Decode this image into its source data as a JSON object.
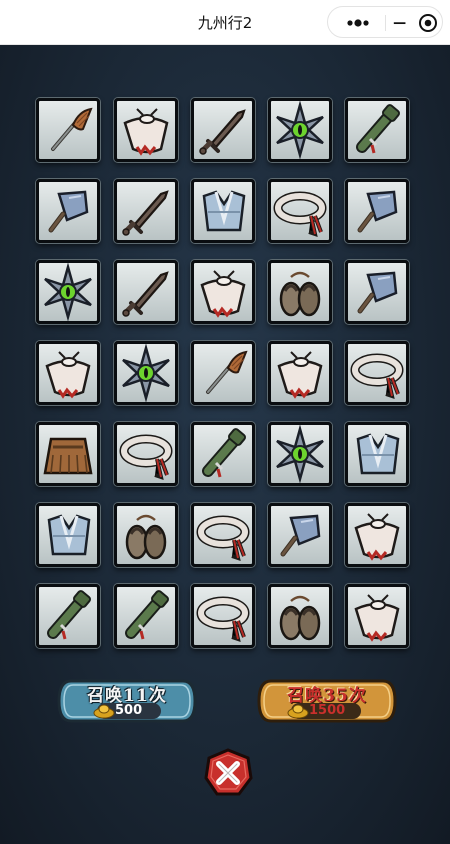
{
  "app": {
    "title": "九州行2"
  },
  "grid": {
    "rows": [
      [
        "broom",
        "scarf",
        "dagger",
        "shuriken",
        "scroll"
      ],
      [
        "cleaver",
        "dagger",
        "vest",
        "headband",
        "cleaver"
      ],
      [
        "shuriken",
        "dagger",
        "scarf",
        "sandals",
        "cleaver"
      ],
      [
        "scarf",
        "shuriken",
        "broom",
        "scarf",
        "headband"
      ],
      [
        "skirt",
        "headband",
        "scroll",
        "shuriken",
        "vest"
      ],
      [
        "vest",
        "sandals",
        "headband",
        "cleaver",
        "scarf"
      ],
      [
        "scroll",
        "scroll",
        "headband",
        "sandals",
        "scarf"
      ]
    ]
  },
  "summon_11": {
    "label": "召唤11次",
    "cost": "500",
    "color": "#4d8ea8"
  },
  "summon_35": {
    "label": "召唤35次",
    "cost": "1500",
    "color": "#d2953a"
  },
  "colors": {
    "accent_red": "#c8302c",
    "slot_bg": "#d6dcdc"
  }
}
